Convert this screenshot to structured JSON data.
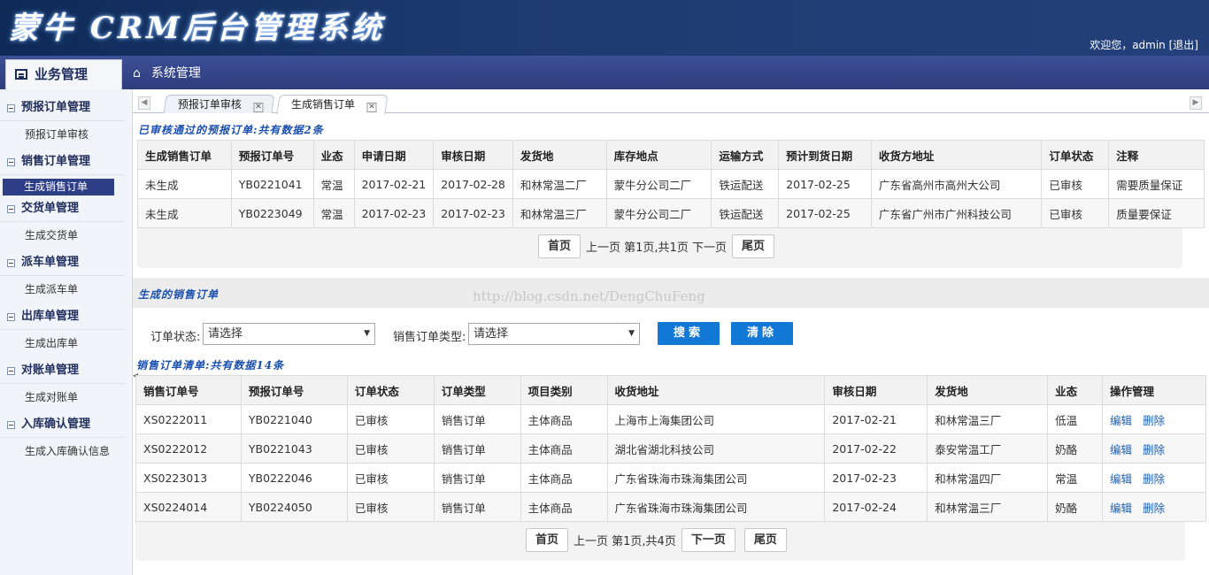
{
  "header": {
    "logo": "蒙牛 CRM后台管理系统",
    "welcome_prefix": "欢迎您，admin",
    "logout": "[退出]"
  },
  "nav": {
    "active": "业务管理",
    "system": "系统管理"
  },
  "sidebar": {
    "groups": [
      {
        "label": "预报订单管理",
        "items": [
          "预报订单审核"
        ]
      },
      {
        "label": "销售订单管理",
        "items": [
          "生成销售订单"
        ]
      },
      {
        "label": "交货单管理",
        "items": [
          "生成交货单"
        ]
      },
      {
        "label": "派车单管理",
        "items": [
          "生成派车单"
        ]
      },
      {
        "label": "出库单管理",
        "items": [
          "生成出库单"
        ]
      },
      {
        "label": "对账单管理",
        "items": [
          "生成对账单"
        ]
      },
      {
        "label": "入库确认管理",
        "items": [
          "生成入库确认信息"
        ]
      }
    ],
    "active_item": "生成销售订单"
  },
  "tabs": [
    {
      "label": "预报订单审核",
      "close": "✕"
    },
    {
      "label": "生成销售订单",
      "close": "✕"
    }
  ],
  "section1": {
    "title": "已审核通过的预报订单:共有数据2条",
    "headers": [
      "生成销售订单",
      "预报订单号",
      "业态",
      "申请日期",
      "审核日期",
      "发货地",
      "库存地点",
      "运输方式",
      "预计到货日期",
      "收货方地址",
      "订单状态",
      "注释"
    ],
    "rows": [
      [
        "未生成",
        "YB0221041",
        "常温",
        "2017-02-21",
        "2017-02-28",
        "和林常温二厂",
        "蒙牛分公司二厂",
        "铁运配送",
        "2017-02-25",
        "广东省高州市高州大公司",
        "已审核",
        "需要质量保证"
      ],
      [
        "未生成",
        "YB0223049",
        "常温",
        "2017-02-23",
        "2017-02-23",
        "和林常温三厂",
        "蒙牛分公司二厂",
        "铁运配送",
        "2017-02-25",
        "广东省广州市广州科技公司",
        "已审核",
        "质量要保证"
      ]
    ],
    "pager": {
      "first": "首页",
      "info": "上一页 第1页,共1页 下一页",
      "last": "尾页"
    }
  },
  "section2": {
    "title": "生成的销售订单",
    "watermark": "http://blog.csdn.net/DengChuFeng",
    "filter": {
      "status_label": "订单状态:",
      "status_value": "请选择",
      "type_label": "销售订单类型:",
      "type_value": "请选择",
      "search": "搜索",
      "clear": "清除"
    },
    "list_title": "销售订单清单:共有数据14条",
    "headers": [
      "销售订单号",
      "预报订单号",
      "订单状态",
      "订单类型",
      "项目类别",
      "收货地址",
      "审核日期",
      "发货地",
      "业态",
      "操作管理"
    ],
    "rows": [
      [
        "XS0222011",
        "YB0221040",
        "已审核",
        "销售订单",
        "主体商品",
        "上海市上海集团公司",
        "2017-02-21",
        "和林常温三厂",
        "低温"
      ],
      [
        "XS0222012",
        "YB0221043",
        "已审核",
        "销售订单",
        "主体商品",
        "湖北省湖北科技公司",
        "2017-02-22",
        "泰安常温工厂",
        "奶酪"
      ],
      [
        "XS0223013",
        "YB0222046",
        "已审核",
        "销售订单",
        "主体商品",
        "广东省珠海市珠海集团公司",
        "2017-02-23",
        "和林常温四厂",
        "常温"
      ],
      [
        "XS0224014",
        "YB0224050",
        "已审核",
        "销售订单",
        "主体商品",
        "广东省珠海市珠海集团公司",
        "2017-02-24",
        "和林常温三厂",
        "奶酪"
      ]
    ],
    "edit": "编辑",
    "delete": "删除",
    "pager": {
      "first": "首页",
      "info": "上一页 第1页,共4页",
      "next": "下一页",
      "last": "尾页"
    }
  }
}
